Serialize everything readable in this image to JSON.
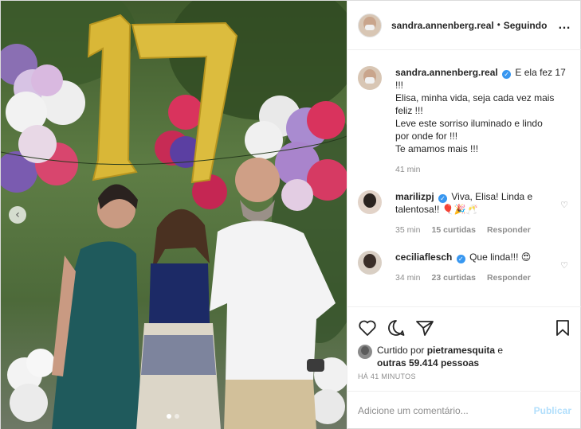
{
  "post": {
    "author": "sandra.annenberg.real",
    "separator": "•",
    "follow_status": "Seguindo",
    "more_icon": "…",
    "photo_alt_icon": "chevron-left-icon"
  },
  "caption": {
    "username": "sandra.annenberg.real",
    "lines": [
      "E ela fez 17",
      "!!!",
      "Elisa, minha vida, seja cada vez mais",
      "feliz !!!",
      "Leve este sorriso iluminado e lindo",
      "por onde for !!!",
      "Te amamos mais !!!"
    ],
    "time": "41 min"
  },
  "comments": [
    {
      "username": "marilizpj",
      "verified": true,
      "text": "Viva, Elisa! Linda e",
      "text2": "talentosa!! 🎈🎉🥂",
      "time": "35 min",
      "likes": "15 curtidas",
      "reply": "Responder"
    },
    {
      "username": "ceciliaflesch",
      "verified": true,
      "text": "Que linda!!! 😍",
      "time": "34 min",
      "likes": "23 curtidas",
      "reply": "Responder"
    }
  ],
  "likes": {
    "prefix": "Curtido por",
    "user": "pietramesquita",
    "mid": "e",
    "others": "outras 59.414 pessoas"
  },
  "timestamp": "HÁ 41 MINUTOS",
  "comment_box": {
    "placeholder": "Adicione um comentário...",
    "publish": "Publicar"
  },
  "colors": {
    "verified": "#3897f0",
    "publish": "#b2dffc",
    "muted": "#8e8e8e",
    "balloon_gold": "#d9b737"
  }
}
